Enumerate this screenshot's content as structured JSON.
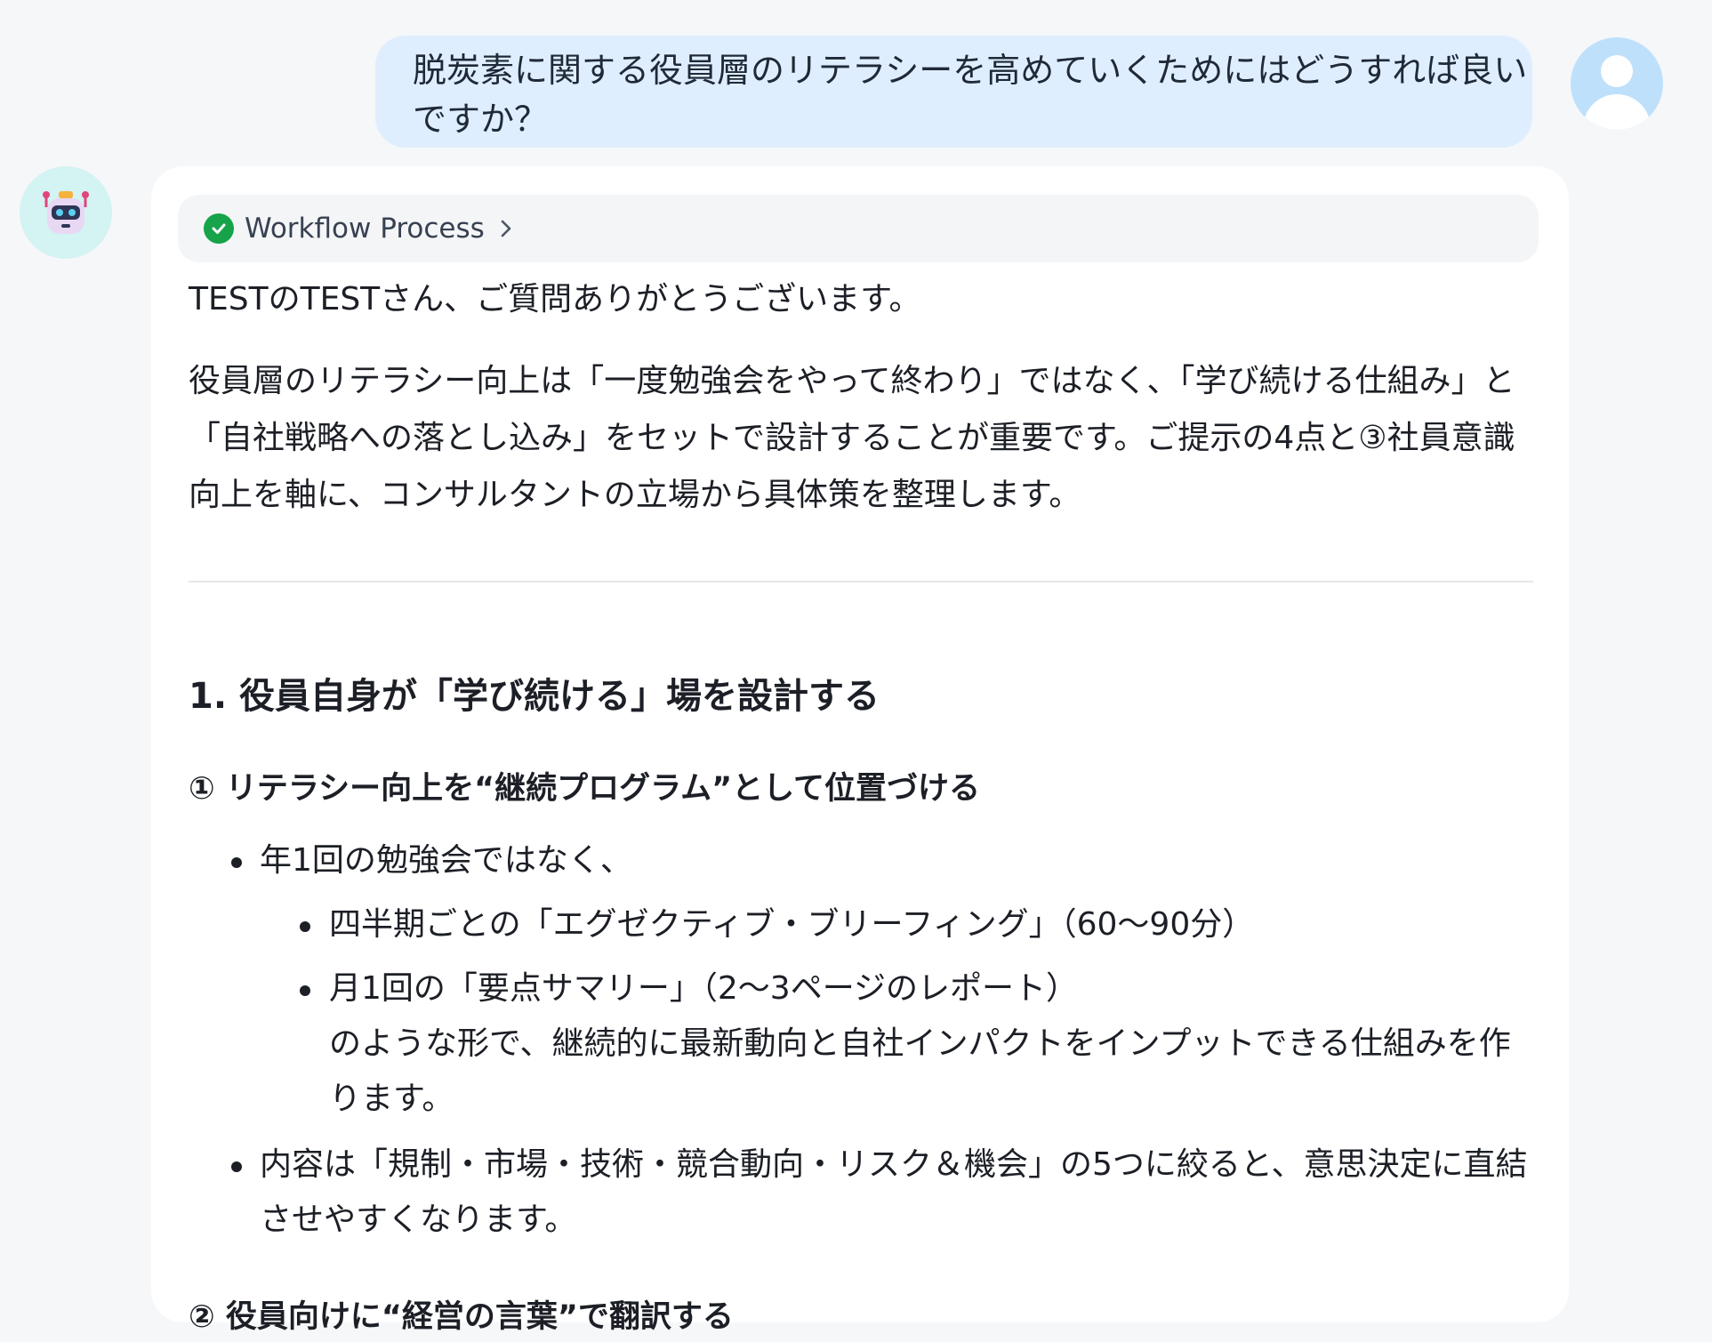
{
  "user_message": {
    "text": "脱炭素に関する役員層のリテラシーを高めていくためにはどうすれば良いですか？"
  },
  "workflow": {
    "label": "Workflow Process"
  },
  "answer": {
    "greeting": "TESTのTESTさん、ご質問ありがとうございます。",
    "intro": "役員層のリテラシー向上は「一度勉強会をやって終わり」ではなく、「学び続ける仕組み」と「自社戦略への落とし込み」をセットで設計することが重要です。ご提示の4点と③社員意識向上を軸に、コンサルタントの立場から具体策を整理します。",
    "section1_heading": "1. 役員自身が「学び続ける」場を設計する",
    "sub1_heading": "① リテラシー向上を“継続プログラム”として位置づける",
    "bullet1": "年1回の勉強会ではなく、",
    "sub_bullet1": "四半期ごとの「エグゼクティブ・ブリーフィング」（60〜90分）",
    "sub_bullet2_line1": "月1回の「要点サマリー」（2〜3ページのレポート）",
    "sub_bullet2_line2": "のような形で、継続的に最新動向と自社インパクトをインプットできる仕組みを作ります。",
    "bullet2": "内容は「規制・市場・技術・競合動向・リスク＆機会」の5つに絞ると、意思決定に直結させやすくなります。",
    "sub2_heading": "② 役員向けに“経営の言葉”で翻訳する"
  },
  "icons": {
    "user_avatar": "user-icon",
    "bot_avatar": "robot-icon",
    "workflow_status": "check-circle-icon",
    "workflow_expand": "chevron-right-icon"
  },
  "colors": {
    "user_bubble": "#dfeefe",
    "check": "#17a34a"
  }
}
